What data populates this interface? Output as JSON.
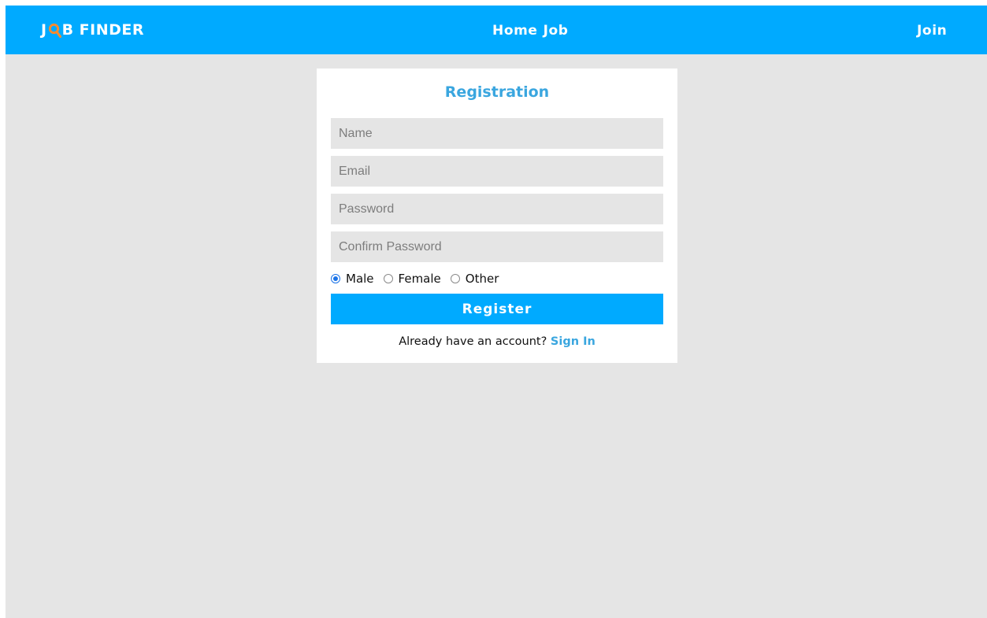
{
  "brand": {
    "logo_prefix": "J",
    "logo_suffix": "B FINDER",
    "logo_icon": "magnifier-icon",
    "colors": {
      "white": "#ffffff",
      "magnifier": "#ff8a2b"
    }
  },
  "navbar": {
    "links": [
      {
        "label": "Home"
      },
      {
        "label": "Job"
      }
    ],
    "join_label": "Join",
    "background": "#00aaff"
  },
  "form": {
    "title": "Registration",
    "fields": {
      "name": {
        "placeholder": "Name",
        "value": ""
      },
      "email": {
        "placeholder": "Email",
        "value": ""
      },
      "password": {
        "placeholder": "Password",
        "value": ""
      },
      "confirm_password": {
        "placeholder": "Confirm Password",
        "value": ""
      }
    },
    "gender": {
      "options": [
        {
          "label": "Male",
          "checked": true
        },
        {
          "label": "Female",
          "checked": false
        },
        {
          "label": "Other",
          "checked": false
        }
      ]
    },
    "register_label": "Register",
    "signin_prompt": "Already have an account?",
    "signin_link": "Sign In",
    "accent": "#3aa6df",
    "button_color": "#00aaff"
  }
}
